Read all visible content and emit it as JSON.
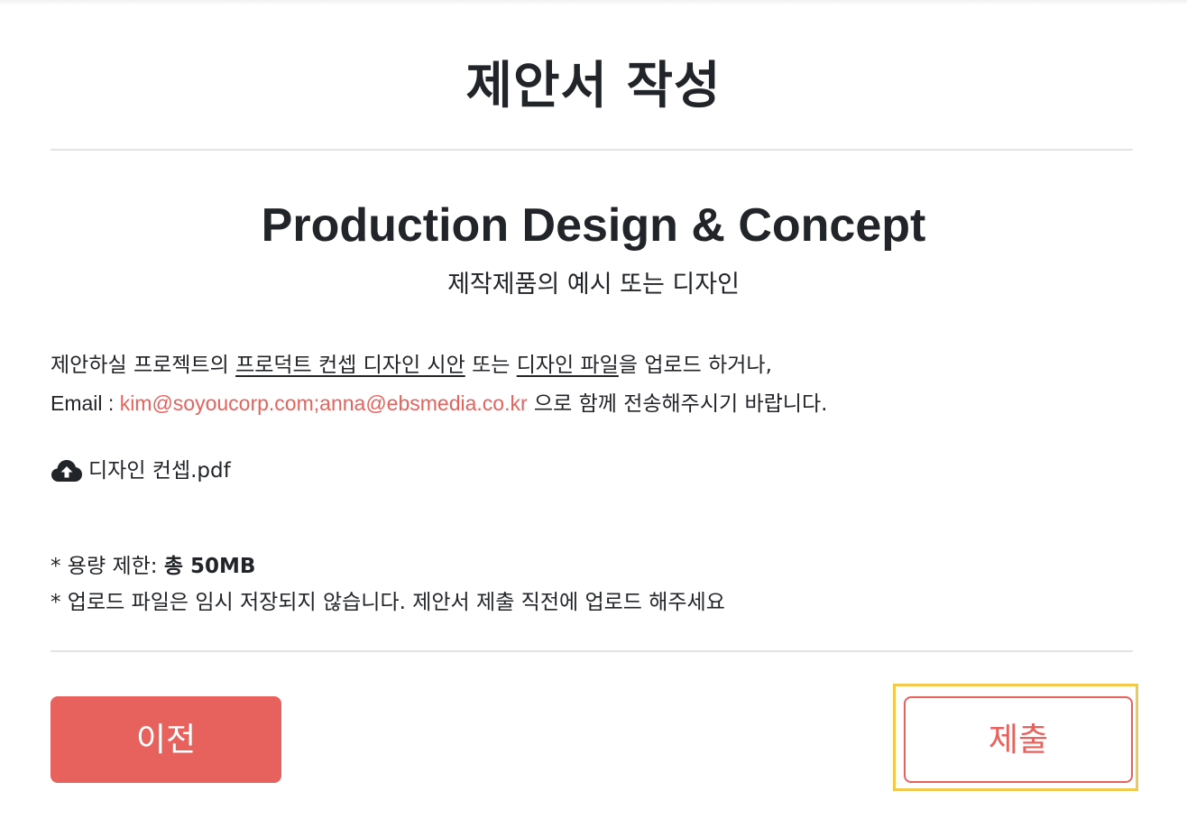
{
  "page": {
    "title": "제안서 작성"
  },
  "section": {
    "title": "Production Design & Concept",
    "subtitle": "제작제품의 예시 또는 디자인"
  },
  "description": {
    "line1_prefix": "제안하실 프로젝트의 ",
    "line1_link1": "프로덕트 컨셉 디자인 시안",
    "line1_middle": " 또는 ",
    "line1_link2": "디자인 파일",
    "line1_suffix": "을 업로드 하거나,",
    "line2_label": "Email : ",
    "email": "kim@soyoucorp.com;anna@ebsmedia.co.kr",
    "line2_suffix": " 으로 함께 전송해주시기 바랍니다."
  },
  "upload": {
    "icon": "cloud-upload-icon",
    "file_name": "디자인 컨셉.pdf"
  },
  "notes": {
    "capacity_prefix": "* 용량 제한: ",
    "capacity_value": "총 50MB",
    "temp_notice": "* 업로드 파일은 임시 저장되지 않습니다. 제안서 제출 직전에 업로드 해주세요"
  },
  "buttons": {
    "prev_label": "이전",
    "submit_label": "제출"
  },
  "colors": {
    "accent": "#e8625d",
    "focus_outline": "#f2c94c",
    "text": "#212529",
    "divider": "#e3e3e3"
  }
}
